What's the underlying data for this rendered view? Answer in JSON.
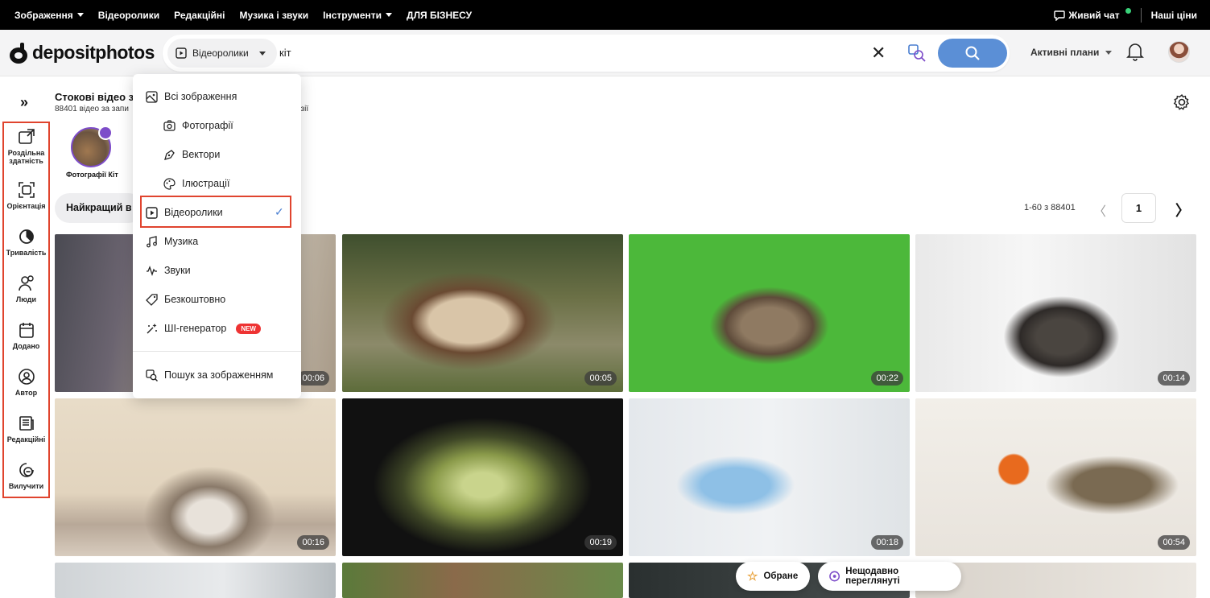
{
  "topbar": {
    "nav": [
      {
        "label": "Зображення",
        "caret": true
      },
      {
        "label": "Відеоролики",
        "caret": false
      },
      {
        "label": "Редакційні",
        "caret": false
      },
      {
        "label": "Музика і звуки",
        "caret": false
      },
      {
        "label": "Інструменти",
        "caret": true
      },
      {
        "label": "ДЛЯ БІЗНЕСУ",
        "caret": false
      }
    ],
    "live_chat": "Живий чат",
    "prices": "Наші ціни"
  },
  "header": {
    "logo": "depositphotos",
    "search_type": "Відеоролики",
    "query": "кіт",
    "plans": "Активні плани"
  },
  "page": {
    "title": "Стокові відео з",
    "subtitle": "88401 відео за запи",
    "subtitle_tail": "нзії",
    "related_label": "Фотографії Кіт",
    "sort_label": "Найкращий в",
    "pager_info": "1-60 з 88401",
    "page_number": "1"
  },
  "filters": [
    {
      "label": "Роздільна здатність",
      "icon": "resolution-icon"
    },
    {
      "label": "Орієнтація",
      "icon": "orientation-icon"
    },
    {
      "label": "Тривалість",
      "icon": "duration-icon"
    },
    {
      "label": "Люди",
      "icon": "people-icon"
    },
    {
      "label": "Додано",
      "icon": "calendar-icon"
    },
    {
      "label": "Автор",
      "icon": "author-icon"
    },
    {
      "label": "Редакційні",
      "icon": "editorial-icon"
    },
    {
      "label": "Вилучити",
      "icon": "exclude-icon"
    }
  ],
  "dropdown": {
    "items": [
      {
        "label": "Всі зображення",
        "icon": "image-icon"
      },
      {
        "label": "Фотографії",
        "icon": "camera-icon"
      },
      {
        "label": "Вектори",
        "icon": "vector-icon"
      },
      {
        "label": "Ілюстрації",
        "icon": "palette-icon"
      },
      {
        "label": "Відеоролики",
        "icon": "video-icon",
        "selected": true
      },
      {
        "label": "Музика",
        "icon": "music-icon"
      },
      {
        "label": "Звуки",
        "icon": "waveform-icon"
      },
      {
        "label": "Безкоштовно",
        "icon": "tag-icon"
      },
      {
        "label": "ШІ-генератор",
        "icon": "sparkle-icon",
        "badge": "NEW"
      }
    ],
    "image_search": "Пошук за зображенням"
  },
  "tiles": [
    {
      "duration": "00:06"
    },
    {
      "duration": "00:05"
    },
    {
      "duration": "00:22"
    },
    {
      "duration": "00:14"
    },
    {
      "duration": "00:16"
    },
    {
      "duration": "00:19"
    },
    {
      "duration": "00:18"
    },
    {
      "duration": "00:54"
    }
  ],
  "bottom": {
    "favorites": "Обране",
    "recent": "Нещодавно переглянуті"
  },
  "colors": {
    "accent": "#5b8fd6",
    "highlight_box": "#e0442e",
    "badge": "#7d4cc9"
  }
}
